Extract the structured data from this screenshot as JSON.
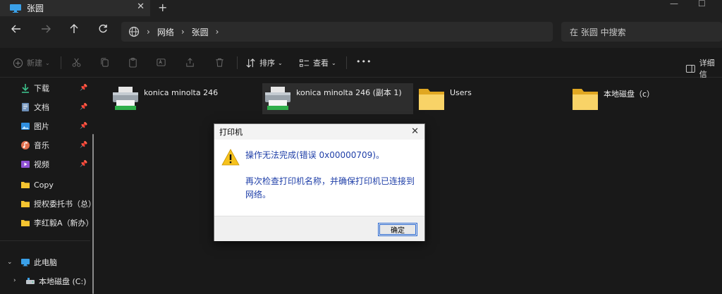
{
  "tab": {
    "title": "张圆",
    "close": "✕"
  },
  "new_tab": "+",
  "nav": {
    "breadcrumb": [
      "网络",
      "张圆"
    ],
    "search_placeholder": "在 张圆 中搜索"
  },
  "toolbar": {
    "new_label": "新建",
    "sort_label": "排序",
    "view_label": "查看",
    "more_label": "•••",
    "details_label": "详细信"
  },
  "sidebar": {
    "quick_access": [
      {
        "label": "下载",
        "icon": "download-icon",
        "pinned": true
      },
      {
        "label": "文档",
        "icon": "document-icon",
        "pinned": true
      },
      {
        "label": "图片",
        "icon": "pictures-icon",
        "pinned": true
      },
      {
        "label": "音乐",
        "icon": "music-icon",
        "pinned": true
      },
      {
        "label": "视频",
        "icon": "video-icon",
        "pinned": true
      },
      {
        "label": "Copy",
        "icon": "folder-icon",
        "pinned": false
      },
      {
        "label": "授权委托书（总）",
        "icon": "folder-icon",
        "pinned": false
      },
      {
        "label": "李红毅A（新办）",
        "icon": "folder-icon",
        "pinned": false
      }
    ],
    "this_pc": "此电脑",
    "local_disk": "本地磁盘 (C:)"
  },
  "items": [
    {
      "name": "konica minolta 246",
      "type": "printer"
    },
    {
      "name": "konica minolta 246 (副本 1)",
      "type": "printer",
      "selected": true
    },
    {
      "name": "Users",
      "type": "folder"
    },
    {
      "name": "本地磁盘（c）",
      "type": "folder"
    }
  ],
  "dialog": {
    "title": "打印机",
    "message": "操作无法完成(错误 0x00000709)。",
    "detail": "再次检查打印机名称，并确保打印机已连接到网络。",
    "ok_label": "确定",
    "close": "✕"
  },
  "colors": {
    "accent": "#2b6bd6",
    "dialog_text": "#1f3fa8",
    "folder": "#f4c430"
  }
}
